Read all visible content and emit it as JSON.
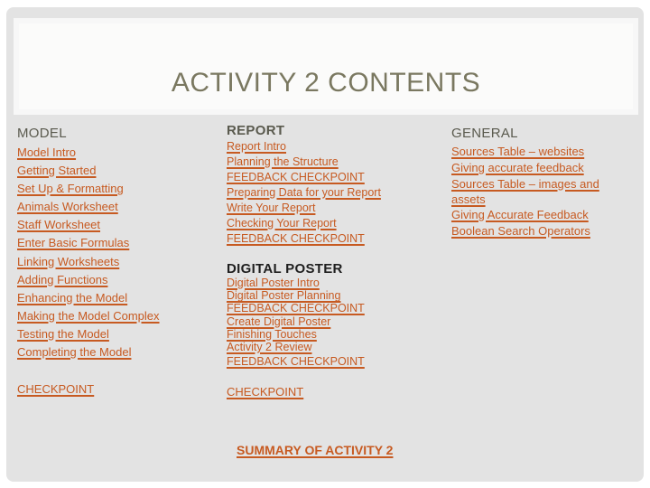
{
  "title": "ACTIVITY 2 CONTENTS",
  "colors": {
    "link": "#c75a21",
    "title": "#7a7860",
    "heading": "#5a5a4e",
    "background": "#e3e3e3"
  },
  "model": {
    "heading": "MODEL",
    "links": [
      "Model Intro",
      "Getting Started",
      "Set Up & Formatting",
      "Animals Worksheet",
      "Staff Worksheet",
      "Enter Basic Formulas",
      "Linking Worksheets",
      "Adding Functions",
      "Enhancing the Model",
      "Making the Model Complex",
      "Testing the Model",
      "Completing the Model"
    ],
    "checkpoint": "CHECKPOINT"
  },
  "report": {
    "heading": "REPORT",
    "links": [
      "Report Intro",
      "Planning the Structure",
      "FEEDBACK CHECKPOINT",
      "Preparing Data for your Report",
      "Write Your Report",
      "Checking Your Report",
      "FEEDBACK CHECKPOINT"
    ]
  },
  "digital_poster": {
    "heading": "DIGITAL POSTER",
    "links": [
      "Digital Poster Intro",
      "Digital Poster Planning",
      "FEEDBACK CHECKPOINT",
      "Create Digital Poster",
      "Finishing Touches",
      "Activity 2 Review",
      "FEEDBACK CHECKPOINT"
    ],
    "checkpoint": "CHECKPOINT"
  },
  "general": {
    "heading": "GENERAL",
    "links": [
      "Sources Table – websites",
      "Giving accurate feedback",
      "Sources Table – images and assets",
      "Giving Accurate Feedback",
      "Boolean Search Operators"
    ]
  },
  "summary_link": "SUMMARY OF ACTIVITY 2"
}
